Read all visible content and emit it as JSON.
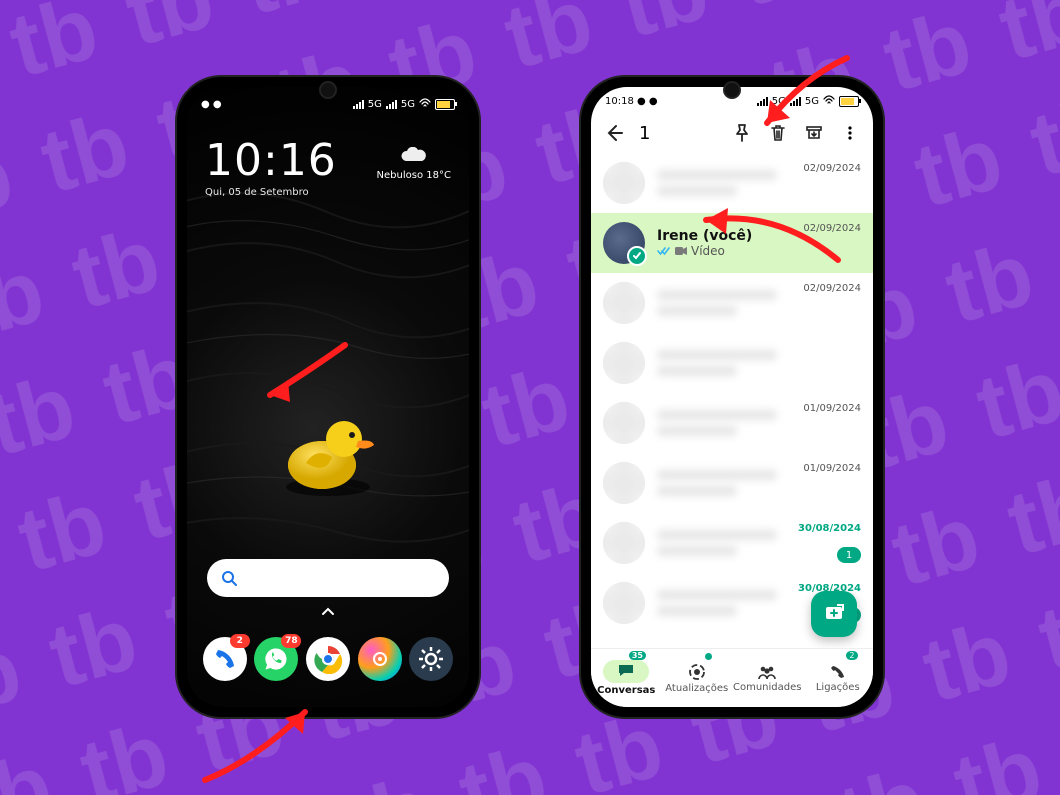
{
  "background": {
    "color": "#8134d1"
  },
  "phone1": {
    "status": {
      "net_type": "5G",
      "battery_pct": "89"
    },
    "clock": {
      "time": "10:16",
      "date": "Qui, 05 de Setembro"
    },
    "weather": {
      "desc": "Nebuloso",
      "temp": "18°C"
    },
    "caret": "^",
    "dock": {
      "phone_badge": "2",
      "whatsapp_badge": "78"
    }
  },
  "phone2": {
    "status": {
      "time": "10:18",
      "net_type": "5G",
      "battery_pct": "89"
    },
    "selection_count": "1",
    "chats": [
      {
        "date": "02/09/2024",
        "selected": false,
        "blur": true
      },
      {
        "name": "Irene (você)",
        "sub": "Vídeo",
        "date": "02/09/2024",
        "selected": true,
        "blur": false
      },
      {
        "date": "02/09/2024",
        "blur": true
      },
      {
        "date": "",
        "blur": true
      },
      {
        "date": "01/09/2024",
        "blur": true
      },
      {
        "date": "01/09/2024",
        "blur": true
      },
      {
        "date": "30/08/2024",
        "blur": true,
        "green": true,
        "unread": "1"
      },
      {
        "date": "30/08/2024",
        "blur": true,
        "green": true,
        "unread": ""
      }
    ],
    "tabs": {
      "conversas": {
        "label": "Conversas",
        "badge": "35"
      },
      "atualizacoes": {
        "label": "Atualizações"
      },
      "comunidades": {
        "label": "Comunidades"
      },
      "ligacoes": {
        "label": "Ligações",
        "badge": "2"
      }
    }
  }
}
